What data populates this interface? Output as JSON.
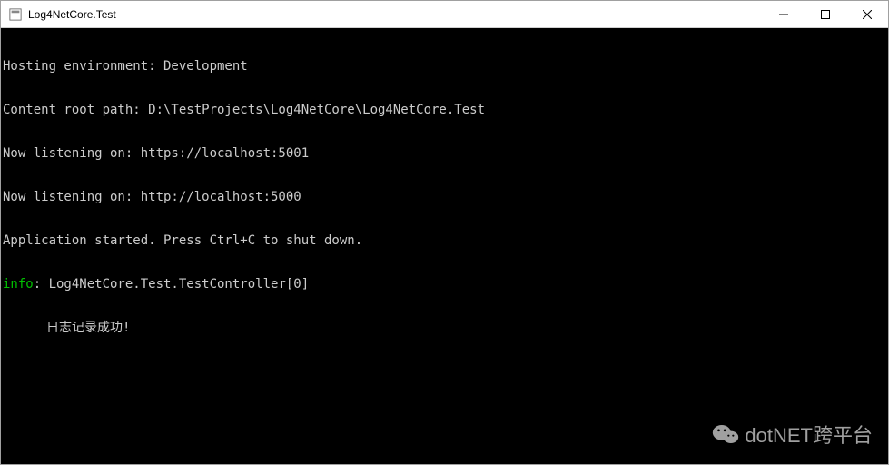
{
  "window": {
    "title": "Log4NetCore.Test"
  },
  "console": {
    "lines": [
      {
        "text": "Hosting environment: Development",
        "color": "default"
      },
      {
        "text": "Content root path: D:\\TestProjects\\Log4NetCore\\Log4NetCore.Test",
        "color": "default"
      },
      {
        "text": "Now listening on: https://localhost:5001",
        "color": "default"
      },
      {
        "text": "Now listening on: http://localhost:5000",
        "color": "default"
      },
      {
        "text": "Application started. Press Ctrl+C to shut down.",
        "color": "default"
      }
    ],
    "info_prefix": "info",
    "info_suffix": ": Log4NetCore.Test.TestController[0]",
    "indented_line": "日志记录成功!"
  },
  "watermark": {
    "text": "dotNET跨平台"
  }
}
